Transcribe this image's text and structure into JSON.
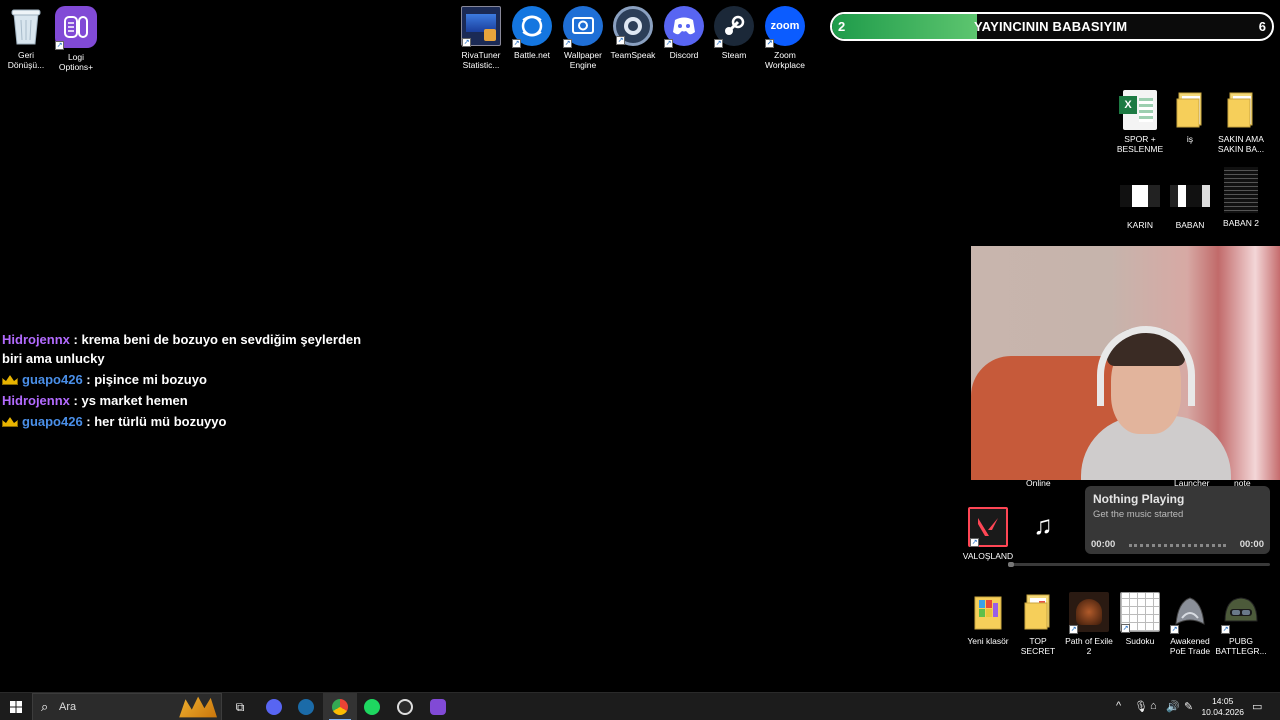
{
  "desktop_icons_left": [
    {
      "name": "recycle-bin",
      "label": "Geri\nDönüşü..."
    },
    {
      "name": "logi-options",
      "label": "Logi\nOptions+"
    }
  ],
  "desktop_icons_top": [
    {
      "name": "rivatuner",
      "label": "RivaTuner\nStatistic..."
    },
    {
      "name": "battlenet",
      "label": "Battle.net"
    },
    {
      "name": "wallpaper-engine",
      "label": "Wallpaper\nEngine"
    },
    {
      "name": "teamspeak",
      "label": "TeamSpeak"
    },
    {
      "name": "discord",
      "label": "Discord"
    },
    {
      "name": "steam",
      "label": "Steam"
    },
    {
      "name": "zoom",
      "label": "Zoom\nWorkplace",
      "logo_text": "zoom"
    }
  ],
  "desktop_icons_right": [
    {
      "name": "spor-beslenme",
      "label": "SPOR +\nBESLENME"
    },
    {
      "name": "is-folder",
      "label": "iş"
    },
    {
      "name": "sakin-ama",
      "label": "SAKIN AMA\nSAKIN BA..."
    },
    {
      "name": "karin",
      "label": "KARIN"
    },
    {
      "name": "baban",
      "label": "BABAN"
    },
    {
      "name": "baban-2",
      "label": "BABAN 2"
    }
  ],
  "desktop_icons_bottom": [
    {
      "name": "yeni-klasor",
      "label": "Yeni klasör"
    },
    {
      "name": "top-secret",
      "label": "TOP SECRET"
    },
    {
      "name": "path-of-exile",
      "label": "Path of Exile\n2"
    },
    {
      "name": "sudoku",
      "label": "Sudoku"
    },
    {
      "name": "awakened-poe",
      "label": "Awakened\nPoE Trade"
    },
    {
      "name": "pubg",
      "label": "PUBG\nBATTLEGR..."
    }
  ],
  "valorant": {
    "label": "VALOŞLAND"
  },
  "partial_labels": {
    "online": "Online",
    "launcher": "Launcher",
    "note": "note"
  },
  "goal_bar": {
    "start": "2",
    "end": "6",
    "title": "YAYINCININ BABASIYIM",
    "progress_fraction": 0.33,
    "color": "#3fb35b"
  },
  "chat": [
    {
      "user": "Hidrojennx",
      "user_color": "#b36bff",
      "text": " : krema beni de bozuyo en sevdiğim şeylerden biri ama unlucky",
      "badge": false
    },
    {
      "user": "guapo426",
      "user_color": "#4a8fe8",
      "text": " : pişince mi bozuyo",
      "badge": true
    },
    {
      "user": "Hidrojennx",
      "user_color": "#b36bff",
      "text": " : ys market hemen",
      "badge": false
    },
    {
      "user": "guapo426",
      "user_color": "#4a8fe8",
      "text": " : her türlü mü bozuyyo",
      "badge": true
    }
  ],
  "media": {
    "title": "Nothing Playing",
    "subtitle": "Get the music started",
    "time_start": "00:00",
    "time_end": "00:00"
  },
  "taskbar": {
    "search_placeholder": "Ara",
    "time": "14:05",
    "date": "10.04.2026"
  }
}
